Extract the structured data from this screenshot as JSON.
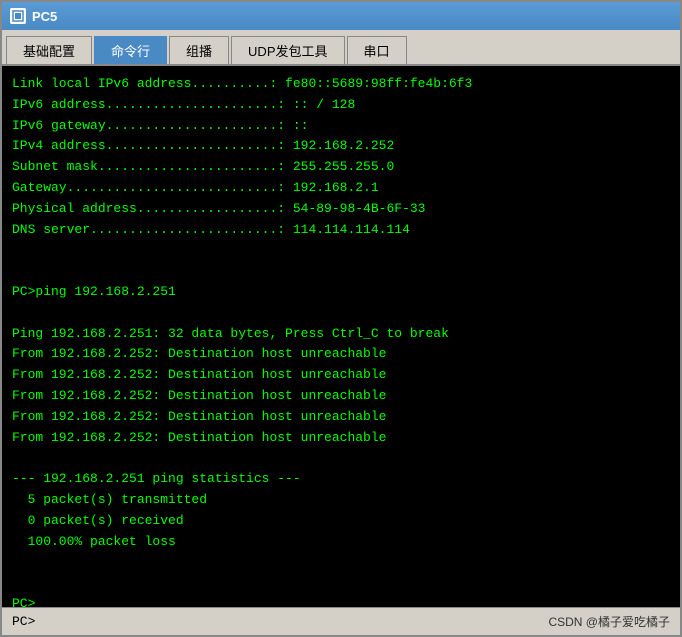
{
  "titleBar": {
    "icon": "PC",
    "title": "PC5"
  },
  "tabs": [
    {
      "id": "basic-config",
      "label": "基础配置",
      "active": false
    },
    {
      "id": "command-line",
      "label": "命令行",
      "active": true
    },
    {
      "id": "multicast",
      "label": "组播",
      "active": false
    },
    {
      "id": "udp-tool",
      "label": "UDP发包工具",
      "active": false
    },
    {
      "id": "serial",
      "label": "串口",
      "active": false
    }
  ],
  "terminal": {
    "content": "Link local IPv6 address..........: fe80::5689:98ff:fe4b:6f3\nIPv6 address......................: :: / 128\nIPv6 gateway......................: ::\nIPv4 address......................: 192.168.2.252\nSubnet mask.......................: 255.255.255.0\nGateway...........................: 192.168.2.1\nPhysical address..................: 54-89-98-4B-6F-33\nDNS server........................: 114.114.114.114\n\n\nPC>ping 192.168.2.251\n\nPing 192.168.2.251: 32 data bytes, Press Ctrl_C to break\nFrom 192.168.2.252: Destination host unreachable\nFrom 192.168.2.252: Destination host unreachable\nFrom 192.168.2.252: Destination host unreachable\nFrom 192.168.2.252: Destination host unreachable\nFrom 192.168.2.252: Destination host unreachable\n\n--- 192.168.2.251 ping statistics ---\n  5 packet(s) transmitted\n  0 packet(s) received\n  100.00% packet loss\n\n\nPC>"
  },
  "bottomBar": {
    "prompt": "PC>",
    "watermark": "CSDN @橘子爱吃橘子"
  }
}
